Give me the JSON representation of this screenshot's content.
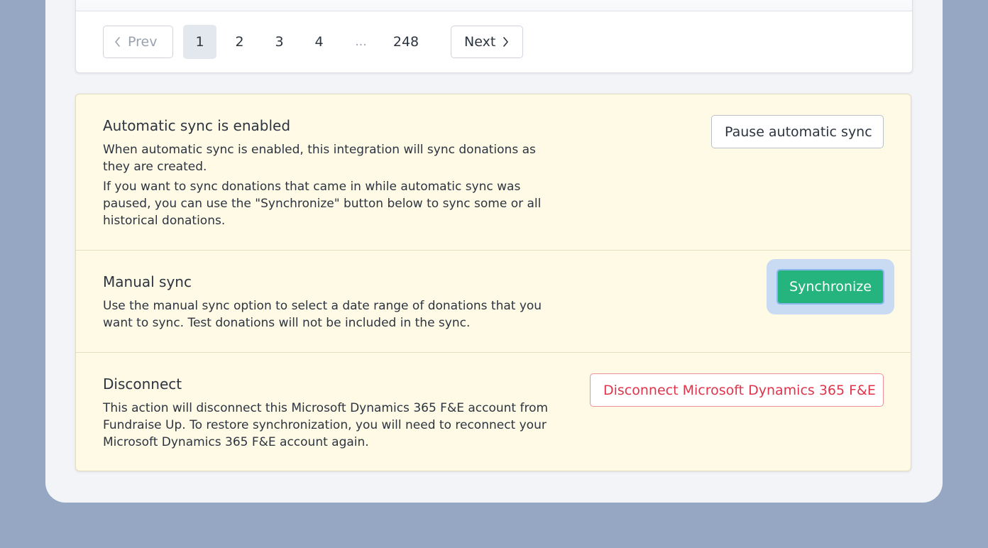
{
  "pagination": {
    "prev_label": "Prev",
    "next_label": "Next",
    "pages": [
      "1",
      "2",
      "3",
      "4"
    ],
    "ellipsis": "...",
    "last_page": "248",
    "current_page": "1"
  },
  "auto_sync": {
    "title": "Automatic sync is enabled",
    "paragraph_1": "When automatic sync is enabled, this integration will sync donations as they are created.",
    "paragraph_2": "If you want to sync donations that came in while automatic sync was paused, you can use the \"Synchronize\" button below to sync some or all historical donations.",
    "button_label": "Pause automatic sync"
  },
  "manual_sync": {
    "title": "Manual sync",
    "paragraph": "Use the manual sync option to select a date range of donations that you want to sync. Test donations will not be included in the sync.",
    "button_label": "Synchronize"
  },
  "disconnect": {
    "title": "Disconnect",
    "paragraph": "This action will disconnect this Microsoft Dynamics 365 F&E account from Fundraise Up. To restore synchronization, you will need to reconnect your Microsoft Dynamics 365 F&E account again.",
    "button_label": "Disconnect Microsoft Dynamics 365 F&E"
  },
  "colors": {
    "page_background": "#95a7c2",
    "panel_background": "#f3f4f7",
    "settings_background": "#fefae6",
    "primary": "#25b47e",
    "danger": "#e0344a",
    "focus_ring": "#c9daf3"
  },
  "icons": {
    "prev": "chevron-left-icon",
    "next": "chevron-right-icon"
  }
}
